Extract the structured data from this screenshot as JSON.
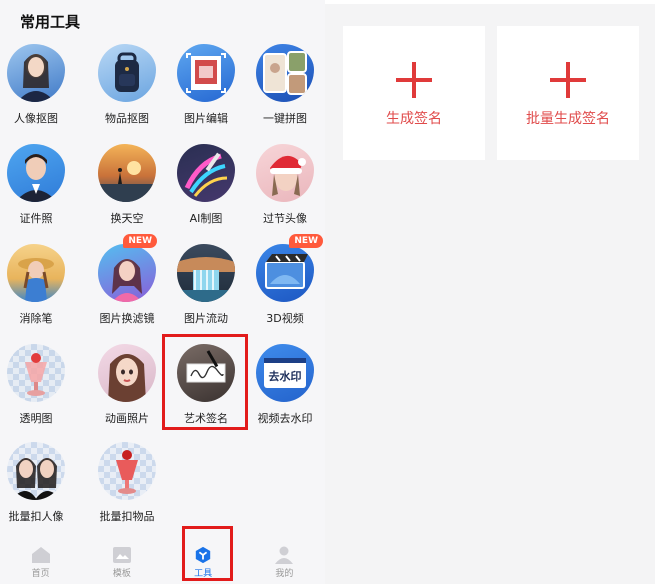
{
  "section_title": "常用工具",
  "tools": [
    {
      "label": "人像抠图",
      "icon": "portrait-cutout-icon"
    },
    {
      "label": "物品抠图",
      "icon": "object-cutout-icon"
    },
    {
      "label": "图片编辑",
      "icon": "image-edit-icon"
    },
    {
      "label": "一键拼图",
      "icon": "collage-icon"
    },
    {
      "label": "证件照",
      "icon": "id-photo-icon"
    },
    {
      "label": "换天空",
      "icon": "sky-replace-icon"
    },
    {
      "label": "AI制图",
      "icon": "ai-draw-icon"
    },
    {
      "label": "过节头像",
      "icon": "holiday-avatar-icon"
    },
    {
      "label": "消除笔",
      "icon": "eraser-icon"
    },
    {
      "label": "图片换滤镜",
      "icon": "filter-icon",
      "badge": "NEW"
    },
    {
      "label": "图片流动",
      "icon": "image-flow-icon"
    },
    {
      "label": "3D视频",
      "icon": "video-3d-icon",
      "badge": "NEW"
    },
    {
      "label": "透明图",
      "icon": "transparent-image-icon"
    },
    {
      "label": "动画照片",
      "icon": "animated-photo-icon"
    },
    {
      "label": "艺术签名",
      "icon": "art-signature-icon"
    },
    {
      "label": "视频去水印",
      "icon": "video-watermark-remove-icon",
      "icon_text": "去水印"
    },
    {
      "label": "批量扣人像",
      "icon": "batch-portrait-icon"
    },
    {
      "label": "批量扣物品",
      "icon": "batch-object-icon"
    }
  ],
  "nav": [
    {
      "label": "首页",
      "icon": "home-icon"
    },
    {
      "label": "模板",
      "icon": "template-icon"
    },
    {
      "label": "工具",
      "icon": "tools-icon",
      "active": true
    },
    {
      "label": "我的",
      "icon": "profile-icon"
    }
  ],
  "cards": [
    {
      "label": "生成签名",
      "icon": "plus-icon"
    },
    {
      "label": "批量生成签名",
      "icon": "plus-icon"
    }
  ],
  "colors": {
    "accent_red": "#e04b4b",
    "highlight_red": "#e21b1b",
    "nav_active": "#1a73e8",
    "badge": "#ff5a3c"
  }
}
